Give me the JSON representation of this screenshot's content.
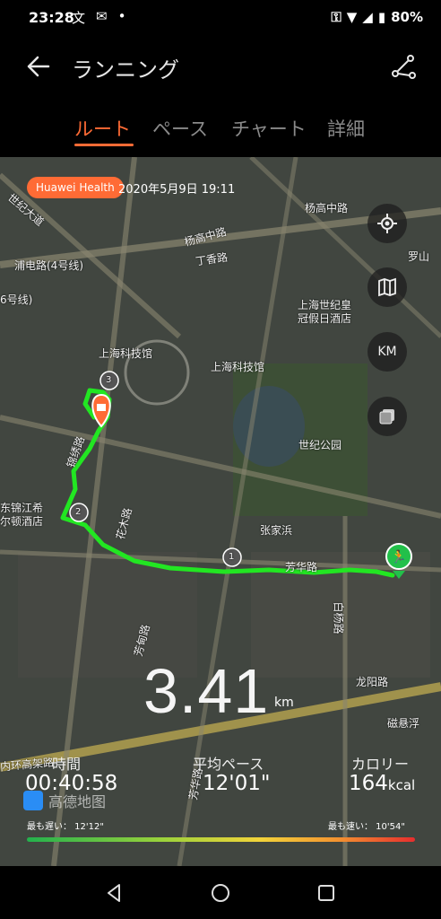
{
  "status_bar": {
    "time": "23:28",
    "battery": "80%"
  },
  "app_bar": {
    "title": "ランニング"
  },
  "tabs": [
    {
      "label": "ルート",
      "active": true
    },
    {
      "label": "ペース",
      "active": false
    },
    {
      "label": "チャート",
      "active": false
    },
    {
      "label": "詳細",
      "active": false
    }
  ],
  "map": {
    "source_badge": "Huawei Health",
    "datetime": "2020年5月9日 19:11",
    "unit_button": "KM",
    "markers": [
      "1",
      "2",
      "3"
    ],
    "places": [
      {
        "name": "杨高中路"
      },
      {
        "name": "杨高中路"
      },
      {
        "name": "丁香路"
      },
      {
        "name": "浦电路(4号线)"
      },
      {
        "name": "6号线)"
      },
      {
        "name": "上海科技馆"
      },
      {
        "name": "上海科技馆"
      },
      {
        "name": "上海世纪皇\n冠假日酒店"
      },
      {
        "name": "世纪公园"
      },
      {
        "name": "东锦江希\n尔顿酒店"
      },
      {
        "name": "锦绣路"
      },
      {
        "name": "花木路"
      },
      {
        "name": "芳甸路"
      },
      {
        "name": "张家浜"
      },
      {
        "name": "芳华路"
      },
      {
        "name": "白杨路"
      },
      {
        "name": "龙阳路"
      },
      {
        "name": "磁悬浮"
      },
      {
        "name": "内环高架路"
      },
      {
        "name": "世纪大道"
      },
      {
        "name": "芳华路"
      },
      {
        "name": "罗山"
      }
    ],
    "amap_logo": "高德地图"
  },
  "summary": {
    "distance": "3.41",
    "distance_unit": "km",
    "time_label": "時間",
    "time_value": "00:40:58",
    "pace_label": "平均ペース",
    "pace_value": "12'01\"",
    "calorie_label": "カロリー",
    "calorie_value": "164",
    "calorie_unit": "kcal",
    "slowest": "最も遅い： 12'12\"",
    "fastest": "最も速い： 10'54\""
  },
  "colors": {
    "accent": "#ff6b35",
    "route": "#22e622"
  }
}
